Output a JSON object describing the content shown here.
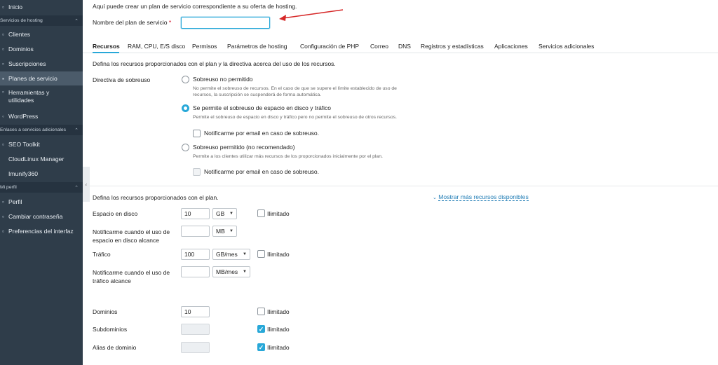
{
  "sidebar": {
    "inicio": "Inicio",
    "section_hosting": "Servicios de hosting",
    "clientes": "Clientes",
    "dominios": "Dominios",
    "suscripciones": "Suscripciones",
    "planes": "Planes de servicio",
    "herramientas": "Herramientas y utilidades",
    "wordpress": "WordPress",
    "section_enlaces": "Enlaces a servicios adicionales",
    "seo": "SEO Toolkit",
    "cloudlinux": "CloudLinux Manager",
    "imunify": "Imunify360",
    "section_perfil": "Mi perfil",
    "perfil": "Perfil",
    "cambiar_pass": "Cambiar contraseña",
    "preferencias": "Preferencias del interfaz"
  },
  "header": {
    "intro": "Aquí puede crear un plan de servicio correspondiente a su oferta de hosting.",
    "plan_name_label": "Nombre del plan de servicio",
    "required_mark": "*",
    "plan_name_value": ""
  },
  "tabs": [
    "Recursos",
    "RAM, CPU, E/S disco",
    "Permisos",
    "Parámetros de hosting",
    "Configuración de PHP",
    "Correo",
    "DNS",
    "Registros y estadísticas",
    "Aplicaciones",
    "Servicios adicionales"
  ],
  "overuse": {
    "intro": "Defina los recursos proporcionados con el plan y la directiva acerca del uso de los recursos.",
    "label": "Directiva de sobreuso",
    "opt1": "Sobreuso no permitido",
    "opt1_desc": "No permite el sobreuso de recursos. En el caso de que se supere el límite establecido de uso de recursos, la suscripción se suspenderá de forma automática.",
    "opt2": "Se permite el sobreuso de espacio en disco y tráfico",
    "opt2_desc": "Permite el sobreuso de espacio en disco y tráfico pero no permite el sobreuso de otros recursos.",
    "opt2_notify": "Notificarme por email en caso de sobreuso.",
    "opt3": "Sobreuso permitido (no recomendado)",
    "opt3_desc": "Permite a los clientes utilizar más recursos de los proporcionados inicialmente por el plan.",
    "opt3_notify": "Notificarme por email en caso de sobreuso."
  },
  "resources": {
    "intro": "Defina los recursos proporcionados con el plan.",
    "more_link": "Mostrar más recursos disponibles",
    "unlimited": "Ilimitado",
    "disk_label": "Espacio en disco",
    "disk_value": "10",
    "disk_unit": "GB",
    "disk_notify_label": "Notificarme cuando el uso de espacio en disco alcance",
    "disk_notify_value": "",
    "disk_notify_unit": "MB",
    "traffic_label": "Tráfico",
    "traffic_value": "100",
    "traffic_unit": "GB/mes",
    "traffic_notify_label": "Notificarme cuando el uso de tráfico alcance",
    "traffic_notify_value": "",
    "traffic_notify_unit": "MB/mes",
    "domains_label": "Dominios",
    "domains_value": "10",
    "subdomains_label": "Subdominios",
    "subdomains_value": "",
    "alias_label": "Alias de dominio",
    "alias_value": ""
  },
  "colors": {
    "sidebar_bg": "#2f3d4a",
    "accent": "#28a8d8",
    "required": "#d0021b",
    "annotation_arrow": "#d62828"
  }
}
